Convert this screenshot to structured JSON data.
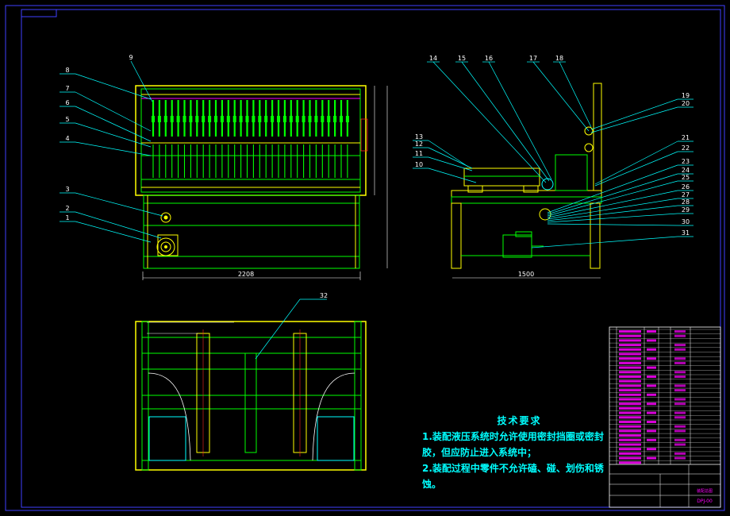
{
  "drawing": {
    "callouts_left_view": [
      "1",
      "2",
      "3",
      "4",
      "5",
      "6",
      "7",
      "8",
      "9"
    ],
    "callouts_right_view": [
      "10",
      "11",
      "12",
      "13",
      "14",
      "15",
      "16",
      "17",
      "18",
      "19",
      "20",
      "21",
      "22",
      "23",
      "24",
      "25",
      "26",
      "27",
      "28",
      "29",
      "30",
      "31"
    ],
    "callout_bottom_view": "32",
    "dim_left_width": "2208",
    "dim_right_width": "1500"
  },
  "notes": {
    "title": "技术要求",
    "line1": "1.装配液压系统时允许使用密封挡圈或密封",
    "line2": "胶，但应防止进入系统中；",
    "line3": "2.装配过程中零件不允许磕、碰、划伤和锈",
    "line4": "蚀。"
  },
  "title_block": {
    "drawing_name": "装配总图",
    "drawing_no": "DPJ-00"
  },
  "colors": {
    "background": "#000000",
    "frame": "#0000ff",
    "outline": "#ffff00",
    "geometry": "#00ff00",
    "callout_lines": "#00ffff",
    "accent": "#ff00ff",
    "dimension": "#ffffff",
    "centerline": "#ff0000"
  }
}
